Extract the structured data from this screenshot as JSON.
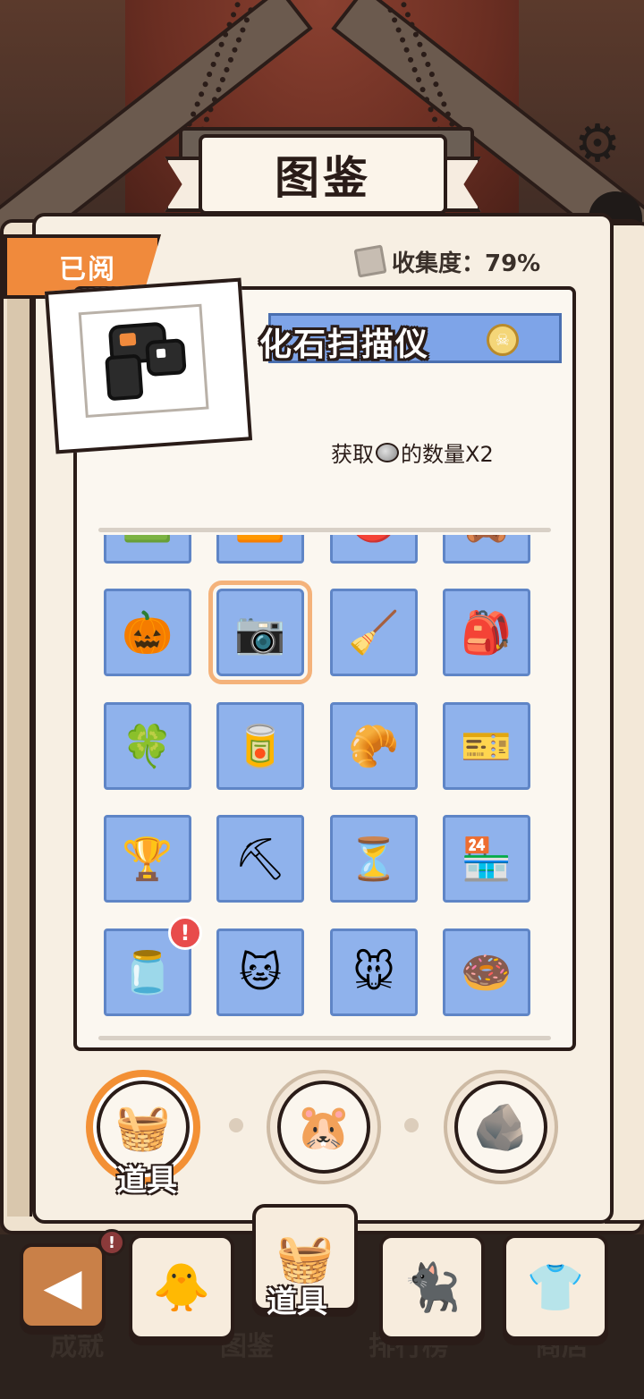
{
  "header": {
    "title": "图鉴"
  },
  "collection": {
    "read_tag": "已阅",
    "progress_label": "收集度：79%"
  },
  "selected_item": {
    "name": "化石扫描仪",
    "effect_prefix": "获取",
    "effect_suffix": "的数量X2"
  },
  "grid": {
    "rows": [
      [
        "?",
        "?",
        "?",
        "?"
      ],
      [
        "🎃",
        "📷",
        "🧹",
        "🎒"
      ],
      [
        "🍀",
        "🥫",
        "🥐",
        "🎫"
      ],
      [
        "🏆",
        "⛏",
        "⏳",
        "🏪"
      ],
      [
        "🫙",
        "🐱",
        "🐭",
        "🍩"
      ]
    ],
    "top_partial": [
      "🟩",
      "🟧",
      "⭕",
      "🧸"
    ],
    "alert_badge": "!"
  },
  "categories": {
    "active_label": "道具",
    "items": [
      "🧺",
      "🐹",
      "🪨"
    ]
  },
  "nav": {
    "labels": [
      "成就",
      "图鉴",
      "排行榜",
      "商店"
    ],
    "active_label": "道具",
    "back_label": "◀",
    "alert_badge": "!",
    "icons": [
      "🐥",
      "🧺",
      "🐈‍⬛",
      "👕"
    ]
  },
  "colors": {
    "accent": "#f08a3c",
    "cell_bg": "#8fb2ec",
    "name_bar": "#7ea4e8",
    "selected_outline": "#f4b27a"
  }
}
